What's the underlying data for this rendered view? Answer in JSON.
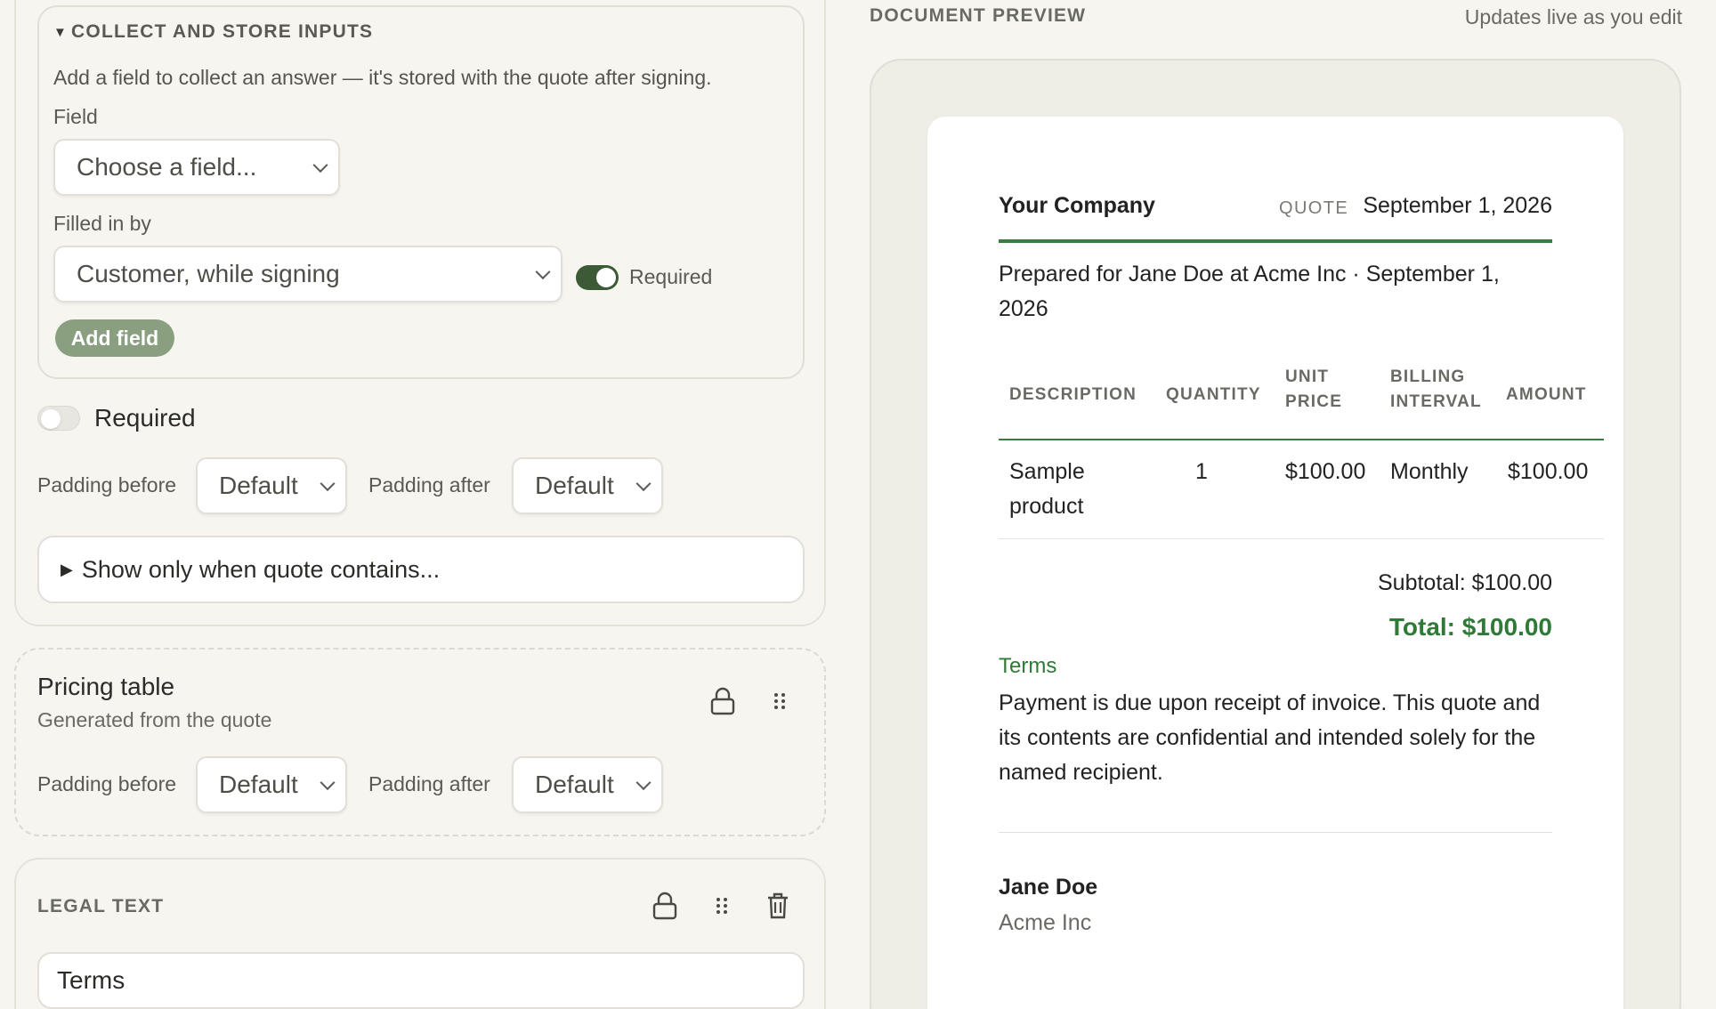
{
  "collect_section": {
    "title": "COLLECT AND STORE INPUTS",
    "helper": "Add a field to collect an answer — it's stored with the quote after signing.",
    "field_label": "Field",
    "field_select": "Choose a field...",
    "filled_by_label": "Filled in by",
    "filled_by_select": "Customer, while signing",
    "required_toggle_on": true,
    "required_label": "Required",
    "add_button": "Add field"
  },
  "block_required": {
    "label": "Required",
    "on": false
  },
  "padding_row_1": {
    "before_label": "Padding before",
    "before_value": "Default",
    "after_label": "Padding after",
    "after_value": "Default"
  },
  "conditional": {
    "label": "Show only when quote contains..."
  },
  "pricing_table": {
    "title": "Pricing table",
    "subtitle": "Generated from the quote",
    "before_label": "Padding before",
    "before_value": "Default",
    "after_label": "Padding after",
    "after_value": "Default"
  },
  "legal_text": {
    "title": "LEGAL TEXT",
    "input_value": "Terms"
  },
  "preview": {
    "heading": "DOCUMENT PREVIEW",
    "note": "Updates live as you edit",
    "company": "Your Company",
    "quote_label": "QUOTE",
    "date": "September 1, 2026",
    "prepared": "Prepared for Jane Doe at Acme Inc · September 1, 2026",
    "table": {
      "headers": [
        "DESCRIPTION",
        "QUANTITY",
        "UNIT PRICE",
        "BILLING INTERVAL",
        "AMOUNT"
      ],
      "rows": [
        [
          "Sample product",
          "1",
          "$100.00",
          "Monthly",
          "$100.00"
        ]
      ]
    },
    "subtotal": "Subtotal: $100.00",
    "total": "Total: $100.00",
    "terms_heading": "Terms",
    "terms_body": "Payment is due upon receipt of invoice. This quote and its contents are confidential and intended solely for the named recipient.",
    "signer_name": "Jane Doe",
    "signer_company": "Acme Inc"
  },
  "colors": {
    "accent_green": "#3b7b3f",
    "toggle_on": "#3d5a36",
    "add_button": "#8a9f80",
    "page_bg": "#f7f5ef"
  }
}
